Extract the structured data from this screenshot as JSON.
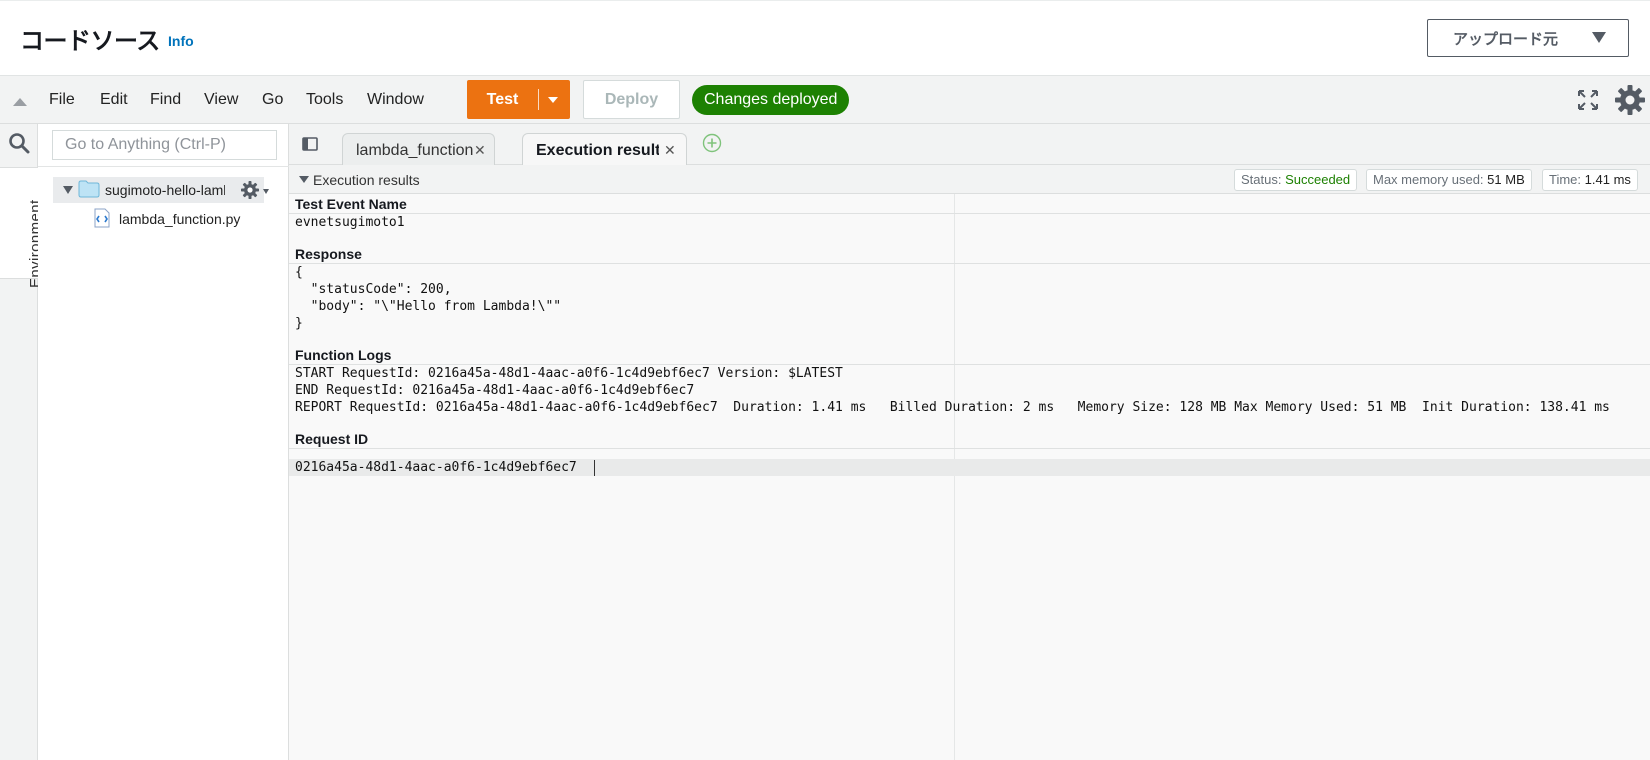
{
  "header": {
    "title": "コードソース",
    "info": "Info",
    "upload_label": "アップロード元"
  },
  "menubar": {
    "items": [
      "File",
      "Edit",
      "Find",
      "View",
      "Go",
      "Tools",
      "Window"
    ],
    "test_label": "Test",
    "deploy_label": "Deploy",
    "deploy_status": "Changes deployed"
  },
  "sidebar": {
    "environment_tab": "Environment",
    "goto_placeholder": "Go to Anything (Ctrl-P)",
    "root_folder": "sugimoto-hello-lambda",
    "file": "lambda_function.py"
  },
  "tabs": [
    {
      "label": "lambda_function",
      "active": false
    },
    {
      "label": "Execution results",
      "active": true
    }
  ],
  "results": {
    "title": "Execution results",
    "status_label": "Status:",
    "status_value": "Succeeded",
    "memory_label": "Max memory used:",
    "memory_value": "51 MB",
    "time_label": "Time:",
    "time_value": "1.41 ms",
    "sections": {
      "test_event_name": {
        "heading": "Test Event Name",
        "value": "evnetsugimoto1"
      },
      "response": {
        "heading": "Response",
        "lines": [
          "{",
          "  \"statusCode\": 200,",
          "  \"body\": \"\\\"Hello from Lambda!\\\"\"",
          "}"
        ]
      },
      "function_logs": {
        "heading": "Function Logs",
        "lines": [
          "START RequestId: 0216a45a-48d1-4aac-a0f6-1c4d9ebf6ec7 Version: $LATEST",
          "END RequestId: 0216a45a-48d1-4aac-a0f6-1c4d9ebf6ec7",
          "REPORT RequestId: 0216a45a-48d1-4aac-a0f6-1c4d9ebf6ec7  Duration: 1.41 ms   Billed Duration: 2 ms   Memory Size: 128 MB Max Memory Used: 51 MB  Init Duration: 138.41 ms"
        ]
      },
      "request_id": {
        "heading": "Request ID",
        "value": "0216a45a-48d1-4aac-a0f6-1c4d9ebf6ec7"
      }
    }
  },
  "colors": {
    "test_button": "#ec7211",
    "deployed_badge": "#1d8102",
    "info_link": "#0073bb",
    "status_succeeded": "#1d8102"
  },
  "icons": [
    "collapse-arrow-icon",
    "fullscreen-icon",
    "settings-gear-icon",
    "search-icon",
    "folder-icon",
    "gear-icon",
    "python-file-icon",
    "tabs-menu-icon",
    "close-icon",
    "add-tab-icon",
    "caret-down-icon"
  ]
}
